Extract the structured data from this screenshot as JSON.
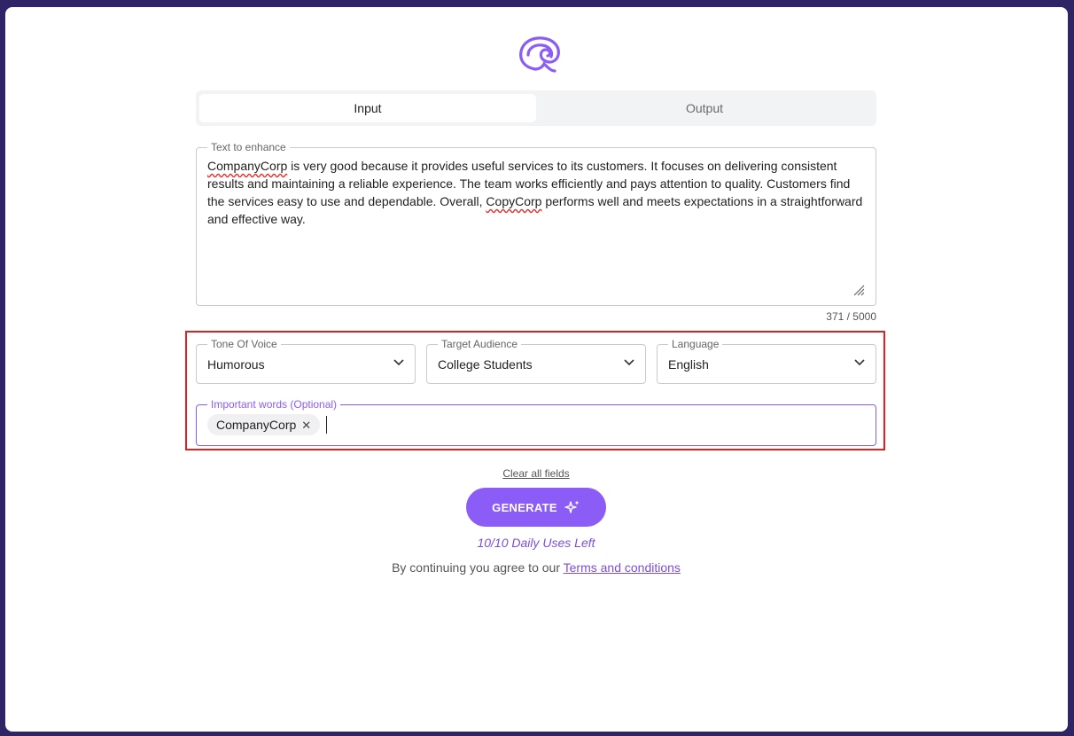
{
  "tabs": [
    {
      "label": "Input",
      "active": true
    },
    {
      "label": "Output",
      "active": false
    }
  ],
  "text_field": {
    "label": "Text to enhance",
    "value_parts": [
      "CompanyCorp",
      " is very good because it provides useful services to its customers. It focuses on delivering consistent results and maintaining a reliable experience. The team works efficiently and pays attention to quality. Customers find the services easy to use and dependable. Overall, ",
      "CopyCorp",
      " performs well and meets expectations in a straightforward and effective way."
    ],
    "counter": "371 / 5000"
  },
  "selects": {
    "tone": {
      "label": "Tone Of Voice",
      "value": "Humorous"
    },
    "audience": {
      "label": "Target Audience",
      "value": "College Students"
    },
    "language": {
      "label": "Language",
      "value": "English"
    }
  },
  "important_words": {
    "label": "Important words (Optional)",
    "chips": [
      "CompanyCorp"
    ]
  },
  "clear_label": "Clear all fields",
  "generate_label": "GENERATE",
  "uses_left": "10/10 Daily Uses Left",
  "terms": {
    "prefix": "By continuing you agree to our ",
    "link": "Terms and conditions"
  },
  "colors": {
    "accent": "#8b5cf6",
    "background": "#2e2466",
    "highlight": "#e02020"
  }
}
